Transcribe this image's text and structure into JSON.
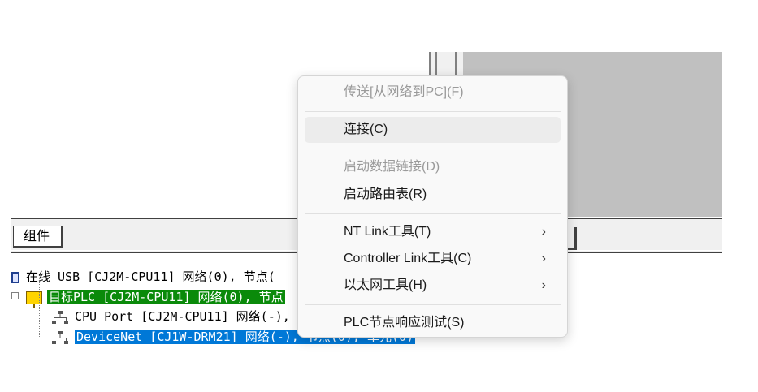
{
  "tabs": {
    "components_label": "组件"
  },
  "tree": {
    "row_online": "在线 USB  [CJ2M-CPU11] 网络(0), 节点(",
    "row_target_plc": "目标PLC [CJ2M-CPU11] 网络(0), 节点",
    "row_cpu_port": "CPU Port [CJ2M-CPU11] 网络(-),",
    "row_devicenet": "DeviceNet [CJ1W-DRM21] 网络(-), 节点(0), 单元(0)",
    "expander_symbol": "−"
  },
  "context_menu": {
    "items": [
      {
        "label": "传送[从网络到PC](F)",
        "enabled": false
      },
      {
        "label": "连接(C)",
        "enabled": true,
        "hover": true
      },
      {
        "label": "启动数据链接(D)",
        "enabled": false
      },
      {
        "label": "启动路由表(R)",
        "enabled": true
      },
      {
        "label": "NT Link工具(T)",
        "enabled": true,
        "submenu": true
      },
      {
        "label": "Controller Link工具(C)",
        "enabled": true,
        "submenu": true
      },
      {
        "label": "以太网工具(H)",
        "enabled": true,
        "submenu": true
      },
      {
        "label": "PLC节点响应测试(S)",
        "enabled": true
      }
    ],
    "submenu_arrow": "›"
  },
  "colors": {
    "menu_bg": "#f9f9f9",
    "disabled_text": "#9a9a9a",
    "green_selection": "#0a8a0a",
    "blue_selection": "#0078d7",
    "panel_gray": "#c0c0c0"
  },
  "icons": [
    "pc-icon",
    "plc-icon",
    "network-icon",
    "chevron-right-icon"
  ]
}
